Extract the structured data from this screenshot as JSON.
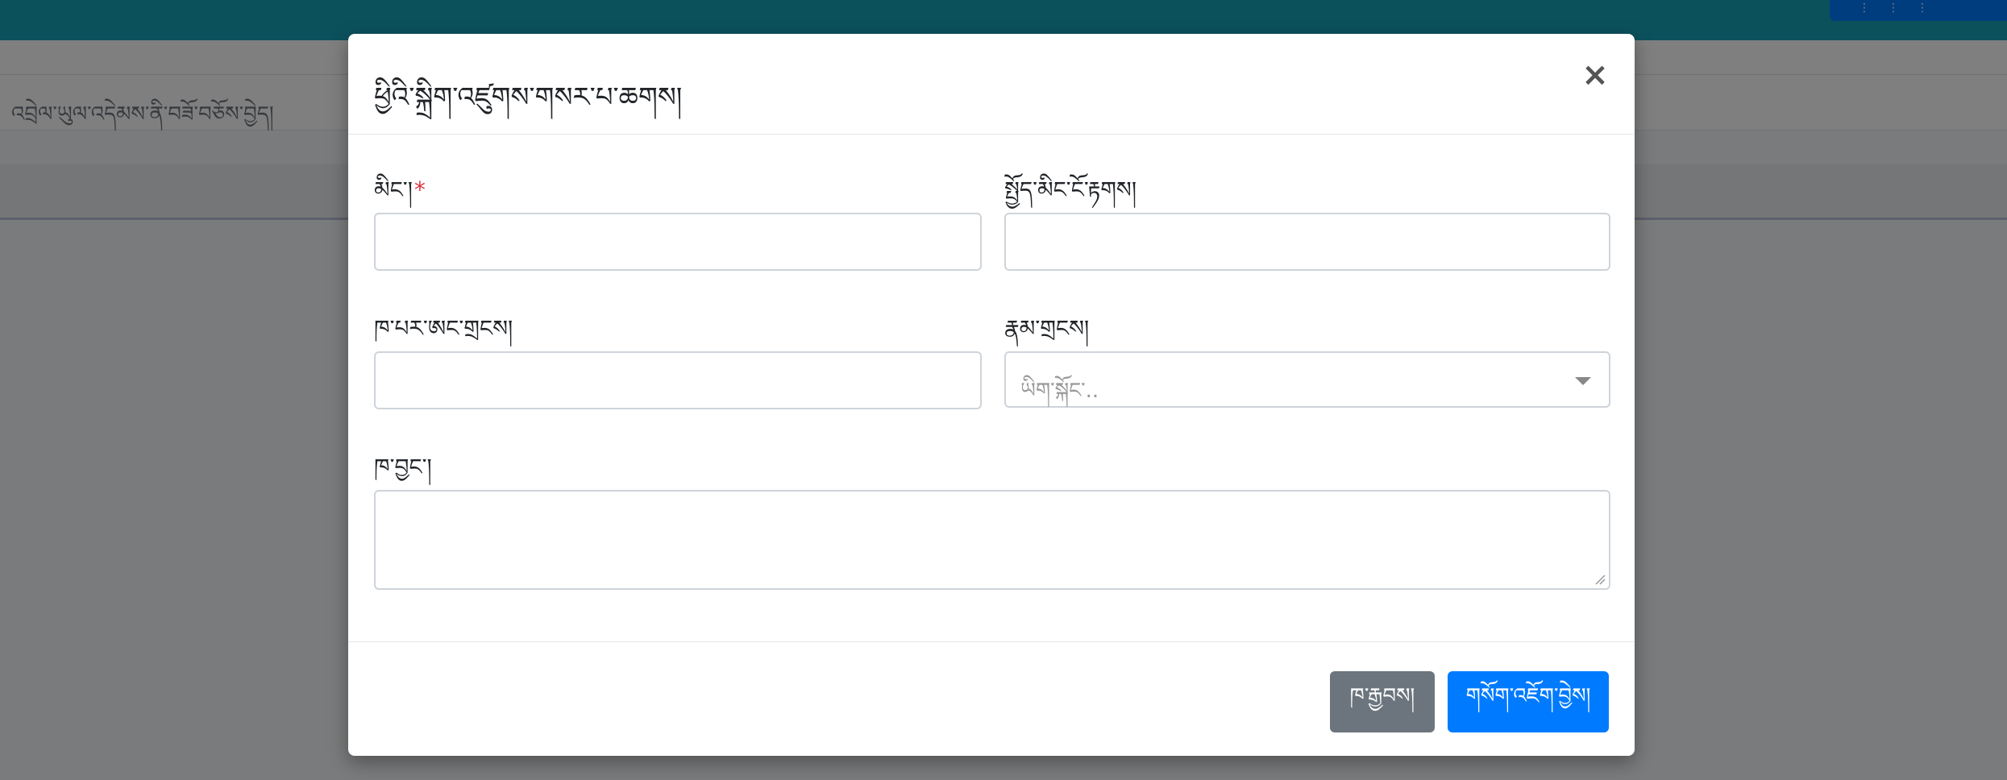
{
  "background": {
    "breadcrumb": "འབྲེལ་ཡུལ་འདེམས་ནི་བཟོ་བཅོས་བྱེད།"
  },
  "modal": {
    "title": "ཕྱིའི་སྐྲིག་འཛུགས་གསར་པ་ཆགས།",
    "close_symbol": "×",
    "fields": {
      "name_label": "མིང་།",
      "name_required_mark": "*",
      "name_value": "",
      "short_name_label": "སྤྱོད་མིང་ངོ་རྟགས།",
      "short_name_value": "",
      "contact_number_label": "ཁ་པར་ཨང་གྲངས།",
      "contact_number_value": "",
      "category_label": "རྣམ་གྲངས།",
      "category_placeholder": "ཡིག་སྐོང་..",
      "address_label": "ཁ་བྱང་།",
      "address_value": ""
    },
    "footer": {
      "cancel_label": "ཁ་རྒྱབས།",
      "save_label": "གསོག་འཇོག་བྱེས།"
    }
  },
  "colors": {
    "header_bg": "#17a2b8",
    "primary": "#007bff",
    "secondary": "#6c757d",
    "required": "#dc3545"
  }
}
